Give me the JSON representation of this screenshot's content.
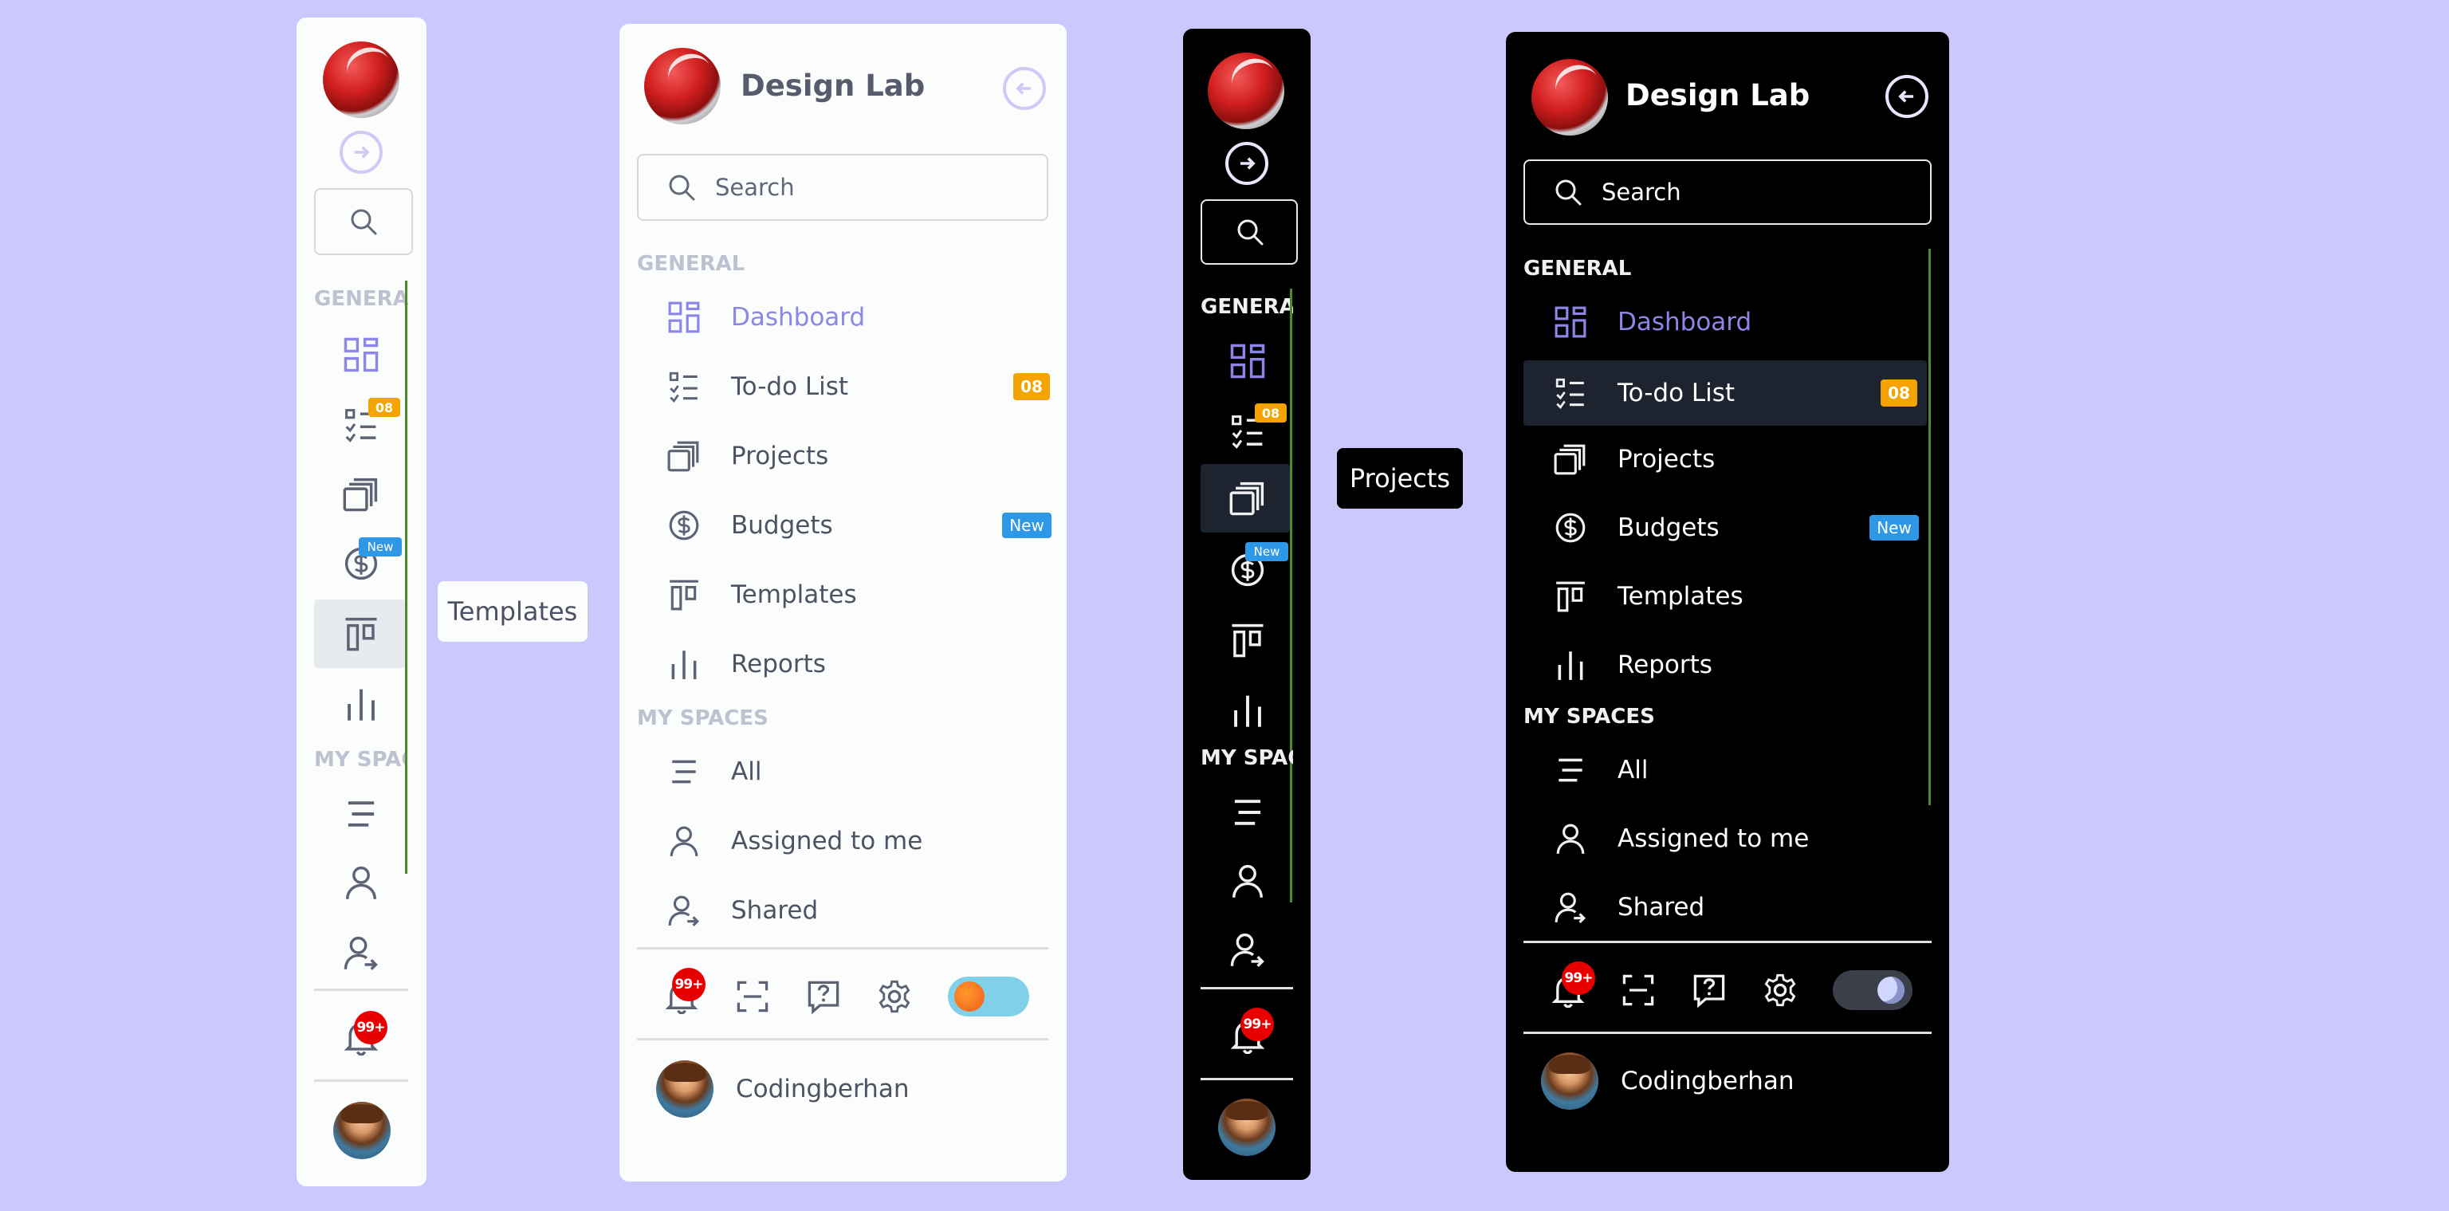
{
  "brand": "Design Lab",
  "search_placeholder": "Search",
  "sections": {
    "general": "GENERAL",
    "my_spaces": "MY SPACES",
    "general_short": "GENERAL",
    "my_spaces_short": "MY SPACE"
  },
  "nav": {
    "dashboard": "Dashboard",
    "todo": "To-do List",
    "projects": "Projects",
    "budgets": "Budgets",
    "templates": "Templates",
    "reports": "Reports",
    "all": "All",
    "assigned": "Assigned to me",
    "shared": "Shared"
  },
  "badges": {
    "todo_count": "08",
    "budgets_new": "New",
    "notifications": "99+"
  },
  "user": {
    "name": "Codingberhan"
  },
  "tooltips": {
    "light": "Templates",
    "dark": "Projects"
  },
  "colors": {
    "background": "#cac8fc",
    "accent": "#8d86e6",
    "todo_badge": "#f5a300",
    "new_badge": "#2e98e6",
    "notification_badge": "#e80000",
    "light_panel": "#fbfcfc",
    "dark_panel": "#000000",
    "scrollbar": "#4d8a2a"
  }
}
